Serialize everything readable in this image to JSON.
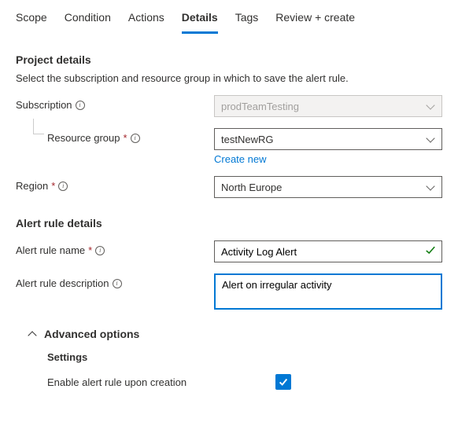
{
  "tabs": {
    "scope": "Scope",
    "condition": "Condition",
    "actions": "Actions",
    "details": "Details",
    "tags": "Tags",
    "review": "Review + create"
  },
  "project": {
    "title": "Project details",
    "desc": "Select the subscription and resource group in which to save the alert rule.",
    "subscription_label": "Subscription",
    "subscription_value": "prodTeamTesting",
    "rg_label": "Resource group",
    "rg_value": "testNewRG",
    "create_new": "Create new",
    "region_label": "Region",
    "region_value": "North Europe"
  },
  "alert": {
    "title": "Alert rule details",
    "name_label": "Alert rule name",
    "name_value": "Activity Log Alert",
    "desc_label": "Alert rule description",
    "desc_value": "Alert on irregular activity"
  },
  "advanced": {
    "title": "Advanced options",
    "settings": "Settings",
    "enable_label": "Enable alert rule upon creation"
  }
}
